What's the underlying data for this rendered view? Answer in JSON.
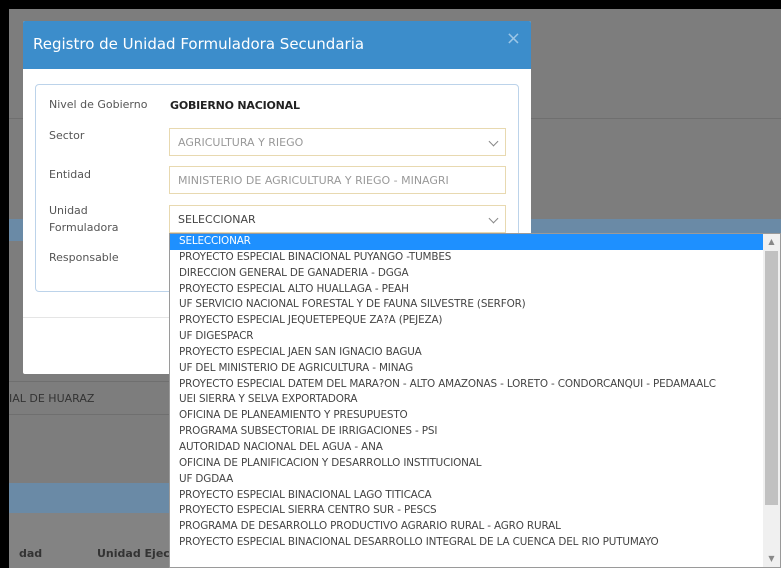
{
  "modal": {
    "title": "Registro de Unidad Formuladora Secundaria",
    "close_glyph": "×",
    "nivel_label": "Nivel de Gobierno",
    "nivel_value": "GOBIERNO NACIONAL",
    "sector_label": "Sector",
    "sector_value": "AGRICULTURA Y RIEGO",
    "entidad_label": "Entidad",
    "entidad_value": "MINISTERIO DE AGRICULTURA Y RIEGO - MINAGRI",
    "unidad_label_1": "Unidad",
    "unidad_label_2": "Formuladora",
    "unidad_value": "SELECCIONAR",
    "responsable_label": "Responsable"
  },
  "background": {
    "row_text": "IAL DE HUARAZ",
    "col_1": "dad",
    "col_2": "Unidad Ejec"
  },
  "dropdown": {
    "selected_index": 0,
    "options": [
      "SELECCIONAR",
      "PROYECTO ESPECIAL BINACIONAL PUYANGO -TUMBES",
      "DIRECCION GENERAL DE GANADERIA - DGGA",
      "PROYECTO ESPECIAL ALTO HUALLAGA - PEAH",
      "UF SERVICIO NACIONAL FORESTAL Y DE FAUNA SILVESTRE (SERFOR)",
      "PROYECTO ESPECIAL JEQUETEPEQUE ZA?A (PEJEZA)",
      "UF DIGESPACR",
      "PROYECTO ESPECIAL JAEN SAN IGNACIO BAGUA",
      "UF DEL MINISTERIO DE AGRICULTURA - MINAG",
      "PROYECTO ESPECIAL DATEM DEL MARA?ON - ALTO AMAZONAS - LORETO - CONDORCANQUI - PEDAMAALC",
      "UEI SIERRA Y SELVA EXPORTADORA",
      "OFICINA DE PLANEAMIENTO Y PRESUPUESTO",
      "PROGRAMA SUBSECTORIAL DE IRRIGACIONES - PSI",
      "AUTORIDAD NACIONAL DEL AGUA - ANA",
      "OFICINA DE PLANIFICACION Y DESARROLLO INSTITUCIONAL",
      "UF DGDAA",
      "PROYECTO ESPECIAL BINACIONAL LAGO TITICACA",
      "PROYECTO ESPECIAL SIERRA CENTRO SUR - PESCS",
      "PROGRAMA DE DESARROLLO PRODUCTIVO AGRARIO RURAL - AGRO RURAL",
      "PROYECTO ESPECIAL BINACIONAL DESARROLLO INTEGRAL DE LA CUENCA DEL RIO PUTUMAYO"
    ]
  },
  "colors": {
    "header": "#3c8dcb",
    "selected_option": "#1e90ff",
    "overlay_bg": "#7d7d7d"
  }
}
